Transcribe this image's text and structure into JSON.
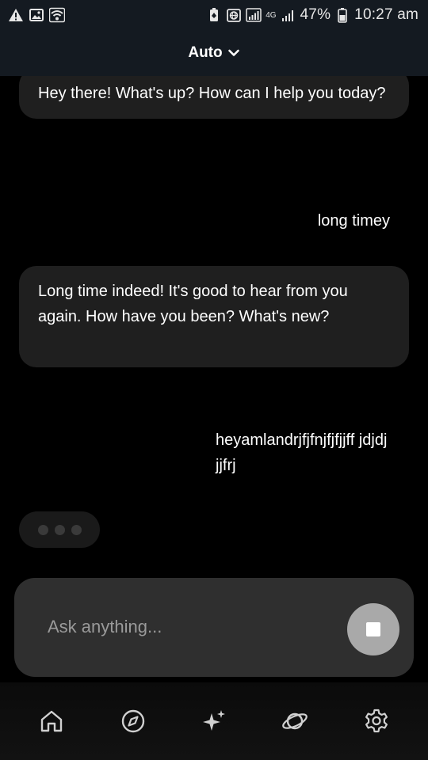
{
  "status_bar": {
    "battery_percent": "47%",
    "time": "10:27 am",
    "network_type": "4G",
    "left_icons": [
      "warning-icon",
      "image-icon",
      "wifi-icon"
    ],
    "right_icons": [
      "battery-saver-icon",
      "globe-icon",
      "signal-icon",
      "network-4g-icon",
      "signal-bars-icon",
      "battery-icon"
    ]
  },
  "header": {
    "model_label": "Auto",
    "dropdown_icon": "chevron-down-icon"
  },
  "messages": [
    {
      "role": "assistant",
      "text": "Hey there! What's up? How can I help you today?"
    },
    {
      "role": "user",
      "text": "long timey"
    },
    {
      "role": "assistant",
      "text": "Long time indeed! It's good to hear from you again. How have you been? What's new?"
    },
    {
      "role": "user",
      "text": "heyamlandrjfjfnjfjfjjff jdjdjjjfrj"
    }
  ],
  "composer": {
    "placeholder": "Ask anything...",
    "value": "",
    "stop_icon": "stop-icon"
  },
  "bottom_nav": {
    "items": [
      {
        "name": "home",
        "icon": "home-icon"
      },
      {
        "name": "explore",
        "icon": "compass-icon"
      },
      {
        "name": "ai",
        "icon": "sparkle-icon"
      },
      {
        "name": "discover",
        "icon": "planet-icon"
      },
      {
        "name": "settings",
        "icon": "gear-icon"
      }
    ]
  },
  "colors": {
    "background": "#000000",
    "header": "#141a21",
    "assistant_bubble": "#1f1f1f",
    "input_box": "#2f2f2f",
    "stop_button": "#a9a9a9"
  }
}
